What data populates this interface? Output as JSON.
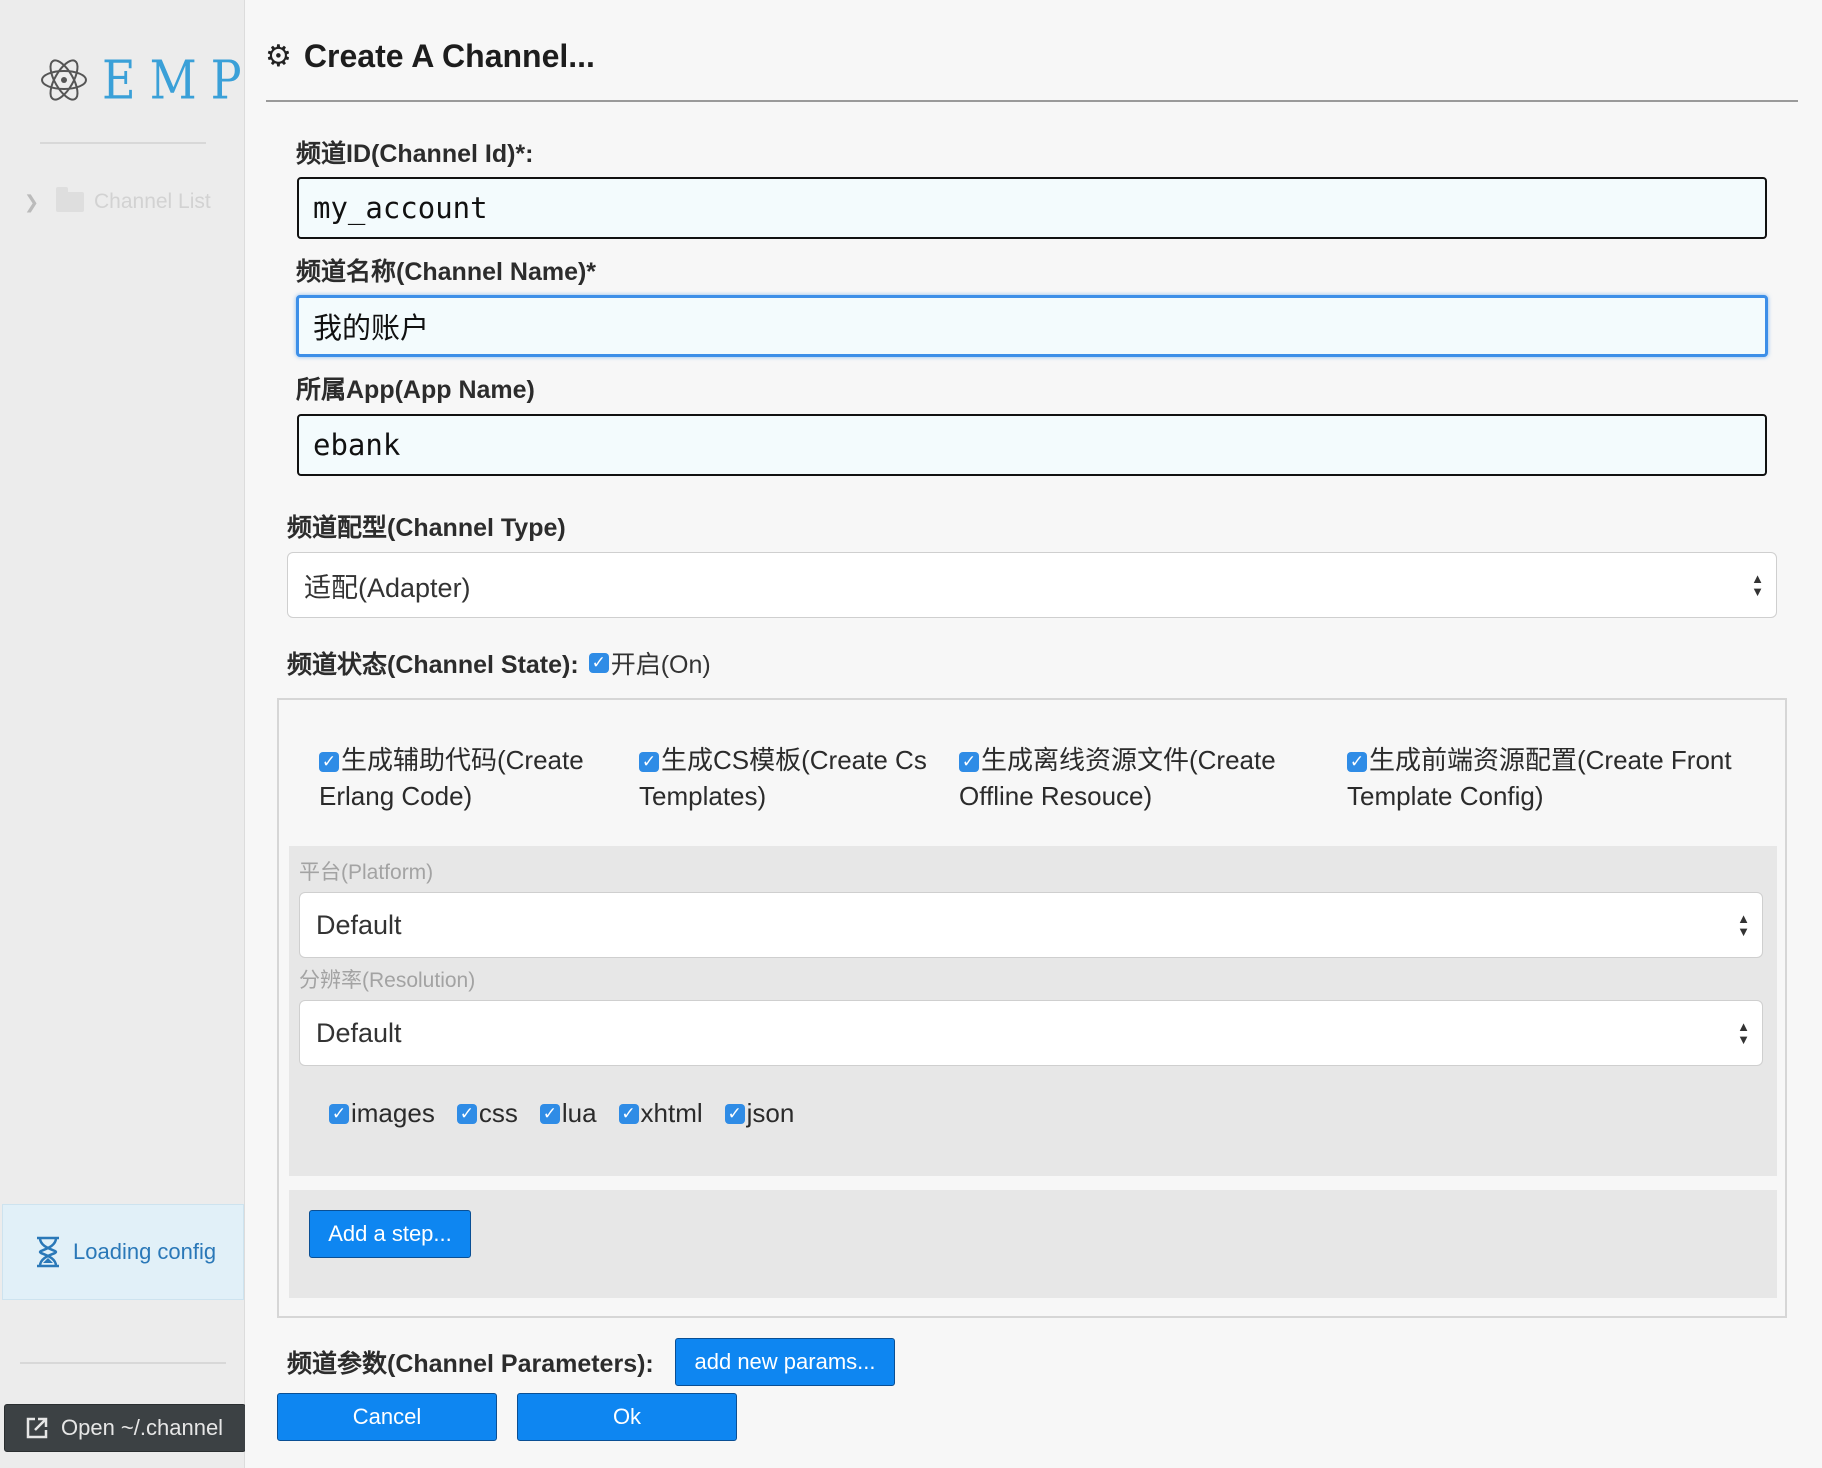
{
  "sidebar": {
    "logo_text": "EMP",
    "tree_item": "Channel List",
    "status_text": "Loading config",
    "open_button": "Open ~/.channel"
  },
  "dialog": {
    "title": "Create A Channel...",
    "channel_id": {
      "label": "频道ID(Channel Id)*:",
      "value": "my_account"
    },
    "channel_name": {
      "label": "频道名称(Channel Name)*",
      "value": "我的账户"
    },
    "app_name": {
      "label": "所属App(App Name)",
      "value": "ebank"
    },
    "channel_type": {
      "label": "频道配型(Channel Type)",
      "value": "适配(Adapter)"
    },
    "channel_state": {
      "label": "频道状态(Channel State):",
      "checkbox_label": "开启(On)",
      "checked": true
    },
    "generate_options": [
      {
        "line1": "生成辅助代码(Create",
        "line2": "Erlang Code)",
        "checked": true
      },
      {
        "line1": "生成CS模板(Create Cs",
        "line2": "Templates)",
        "checked": true
      },
      {
        "line1": "生成离线资源文件(Create",
        "line2": "Offline Resouce)",
        "checked": true
      },
      {
        "line1": "生成前端资源配置(Create Front",
        "line2": "Template Config)",
        "checked": true
      }
    ],
    "platform": {
      "label": "平台(Platform)",
      "value": "Default"
    },
    "resolution": {
      "label": "分辨率(Resolution)",
      "value": "Default"
    },
    "file_types": [
      {
        "label": "images",
        "checked": true
      },
      {
        "label": "css",
        "checked": true
      },
      {
        "label": "lua",
        "checked": true
      },
      {
        "label": "xhtml",
        "checked": true
      },
      {
        "label": "json",
        "checked": true
      }
    ],
    "add_step_button": "Add a step...",
    "channel_parameters": {
      "label": "频道参数(Channel Parameters):",
      "button": "add new params..."
    },
    "cancel_button": "Cancel",
    "ok_button": "Ok"
  },
  "colors": {
    "accent": "#0e86f1",
    "logo": "#3aa0d8",
    "checkbox": "#2f8ce6"
  }
}
